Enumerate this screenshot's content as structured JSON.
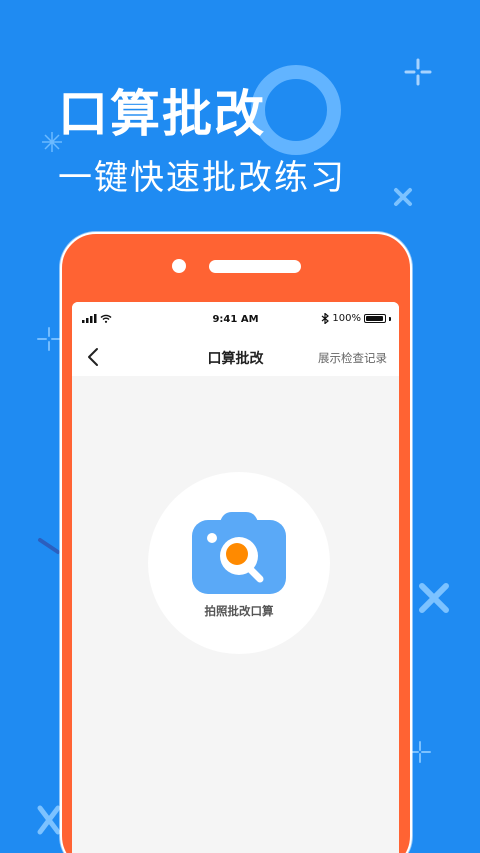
{
  "hero": {
    "title": "口算批改",
    "subtitle": "一键快速批改练习"
  },
  "status_bar": {
    "time": "9:41 AM",
    "battery": "100%"
  },
  "nav": {
    "title": "口算批改",
    "right_link": "展示检查记录"
  },
  "camera_card": {
    "label": "拍照批改口算"
  },
  "colors": {
    "background": "#1f8bf2",
    "phone_frame": "#ff6333",
    "camera_icon": "#5aa9f7",
    "lens_center": "#ff8a00"
  }
}
